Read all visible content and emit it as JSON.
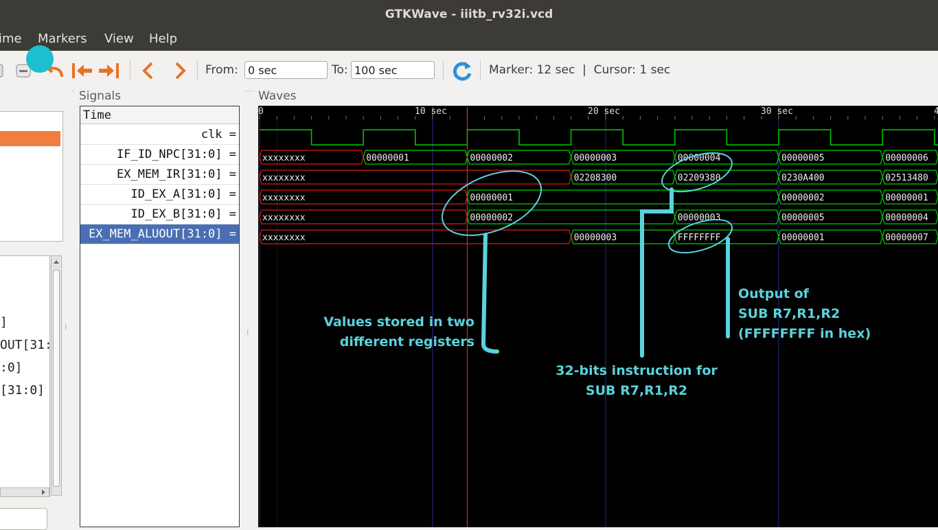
{
  "window": {
    "title": "GTKWave - iiitb_rv32i.vcd"
  },
  "menu": [
    "ime",
    "Markers",
    "View",
    "Help"
  ],
  "toolbar": {
    "from_label": "From:",
    "from_value": "0 sec",
    "to_label": "To:",
    "to_value": "100 sec",
    "marker_text": "Marker: 12 sec  |  Cursor: 1 sec"
  },
  "left_panel": {
    "list_items": [
      "]",
      "OUT[31:",
      ":0]",
      "[31:0]"
    ]
  },
  "signals": {
    "label": "Signals",
    "time_header": "Time",
    "rows": [
      "clk =",
      "IF_ID_NPC[31:0] =",
      "EX_MEM_IR[31:0] =",
      "ID_EX_A[31:0] =",
      "ID_EX_B[31:0] =",
      "EX_MEM_ALUOUT[31:0] ="
    ]
  },
  "waves": {
    "label": "Waves",
    "time_ticks": [
      {
        "t": 0,
        "label": "0"
      },
      {
        "t": 10,
        "label": "10 sec"
      },
      {
        "t": 20,
        "label": "20 sec"
      },
      {
        "t": 30,
        "label": "30 sec"
      },
      {
        "t": 40,
        "label": "4"
      }
    ],
    "marker_time": 12,
    "cursor_time": 1,
    "clk_period": 6,
    "buses": [
      {
        "name": "IF_ID_NPC[31:0]",
        "segments": [
          {
            "t0": 0,
            "t1": 6,
            "value": "xxxxxxxx",
            "unknown": true
          },
          {
            "t0": 6,
            "t1": 12,
            "value": "00000001"
          },
          {
            "t0": 12,
            "t1": 18,
            "value": "00000002"
          },
          {
            "t0": 18,
            "t1": 24,
            "value": "00000003"
          },
          {
            "t0": 24,
            "t1": 30,
            "value": "00000004"
          },
          {
            "t0": 30,
            "t1": 36,
            "value": "00000005"
          },
          {
            "t0": 36,
            "t1": 42,
            "value": "00000006"
          }
        ]
      },
      {
        "name": "EX_MEM_IR[31:0]",
        "segments": [
          {
            "t0": 0,
            "t1": 18,
            "value": "xxxxxxxx",
            "unknown": true
          },
          {
            "t0": 18,
            "t1": 24,
            "value": "02208300"
          },
          {
            "t0": 24,
            "t1": 30,
            "value": "02209380"
          },
          {
            "t0": 30,
            "t1": 36,
            "value": "0230A400"
          },
          {
            "t0": 36,
            "t1": 42,
            "value": "02513480"
          }
        ]
      },
      {
        "name": "ID_EX_A[31:0]",
        "segments": [
          {
            "t0": 0,
            "t1": 12,
            "value": "xxxxxxxx",
            "unknown": true
          },
          {
            "t0": 12,
            "t1": 30,
            "value": "00000001"
          },
          {
            "t0": 30,
            "t1": 36,
            "value": "00000002"
          },
          {
            "t0": 36,
            "t1": 42,
            "value": "00000001"
          }
        ]
      },
      {
        "name": "ID_EX_B[31:0]",
        "segments": [
          {
            "t0": 0,
            "t1": 12,
            "value": "xxxxxxxx",
            "unknown": true
          },
          {
            "t0": 12,
            "t1": 24,
            "value": "00000002"
          },
          {
            "t0": 24,
            "t1": 30,
            "value": "00000003"
          },
          {
            "t0": 30,
            "t1": 36,
            "value": "00000005"
          },
          {
            "t0": 36,
            "t1": 42,
            "value": "00000004"
          }
        ]
      },
      {
        "name": "EX_MEM_ALUOUT[31:0]",
        "segments": [
          {
            "t0": 0,
            "t1": 18,
            "value": "xxxxxxxx",
            "unknown": true
          },
          {
            "t0": 18,
            "t1": 24,
            "value": "00000003"
          },
          {
            "t0": 24,
            "t1": 30,
            "value": "FFFFFFFF"
          },
          {
            "t0": 30,
            "t1": 36,
            "value": "00000001"
          },
          {
            "t0": 36,
            "t1": 42,
            "value": "00000007"
          }
        ]
      }
    ]
  },
  "annotations": {
    "registers_line1": "Values stored in two",
    "registers_line2": "different registers",
    "instruction_line1": "32-bits instruction for",
    "instruction_line2": "SUB R7,R1,R2",
    "output_line1": "Output of",
    "output_line2": "SUB R7,R1,R2",
    "output_line3": "(FFFFFFFF in hex)",
    "color": "#5ad3dc"
  },
  "colors": {
    "titlebar": "#3c3b37",
    "wave_green": "#00d000",
    "wave_red": "#e01818",
    "marker_line": "#e23a3a",
    "grid_blue": "#2a2a8a",
    "selection": "#4a6eb3",
    "orange_select": "#ef7e40"
  }
}
